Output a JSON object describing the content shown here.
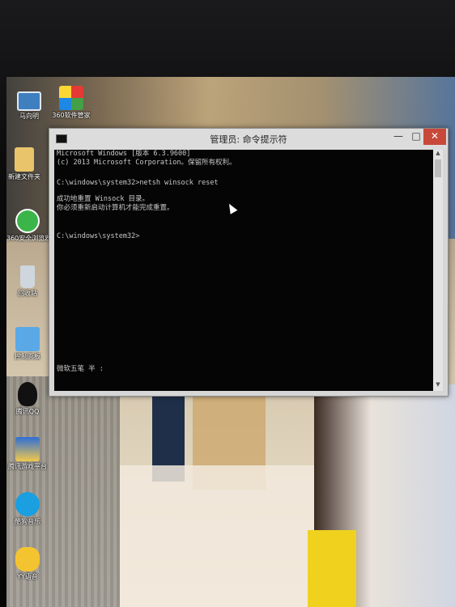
{
  "desktop": {
    "icons": [
      {
        "label": "马向明",
        "icon": "computer-icon"
      },
      {
        "label": "360软件管家",
        "icon": "360-software-manager-icon"
      },
      {
        "label": "新建文件夹",
        "icon": "folder-icon"
      },
      {
        "label": "360安全浏览器",
        "icon": "360-browser-icon"
      },
      {
        "label": "回收站",
        "icon": "recycle-bin-icon"
      },
      {
        "label": "控制面板",
        "icon": "control-panel-icon"
      },
      {
        "label": "腾讯QQ",
        "icon": "qq-icon"
      },
      {
        "label": "腾讯游戏平台",
        "icon": "tencent-games-icon"
      },
      {
        "label": "酷狗音乐",
        "icon": "kugou-music-icon"
      },
      {
        "label": "YY语音",
        "icon": "yy-icon"
      }
    ]
  },
  "window": {
    "title": "管理员: 命令提示符",
    "app_icon": "cmd-icon",
    "controls": {
      "minimize": "—",
      "maximize": "□",
      "close": "✕"
    }
  },
  "console": {
    "lines": [
      "Microsoft Windows [版本 6.3.9600]",
      "(c) 2013 Microsoft Corporation。保留所有权利。",
      "C:\\windows\\system32>netsh winsock reset",
      "成功地重置 Winsock 目录。",
      "你必须重新启动计算机才能完成重置。",
      "C:\\windows\\system32>"
    ],
    "ime_status": "微软五笔 半 :"
  },
  "colors": {
    "console_bg": "#050505",
    "console_text": "#c8c8c8",
    "close_button": "#c8493a"
  }
}
